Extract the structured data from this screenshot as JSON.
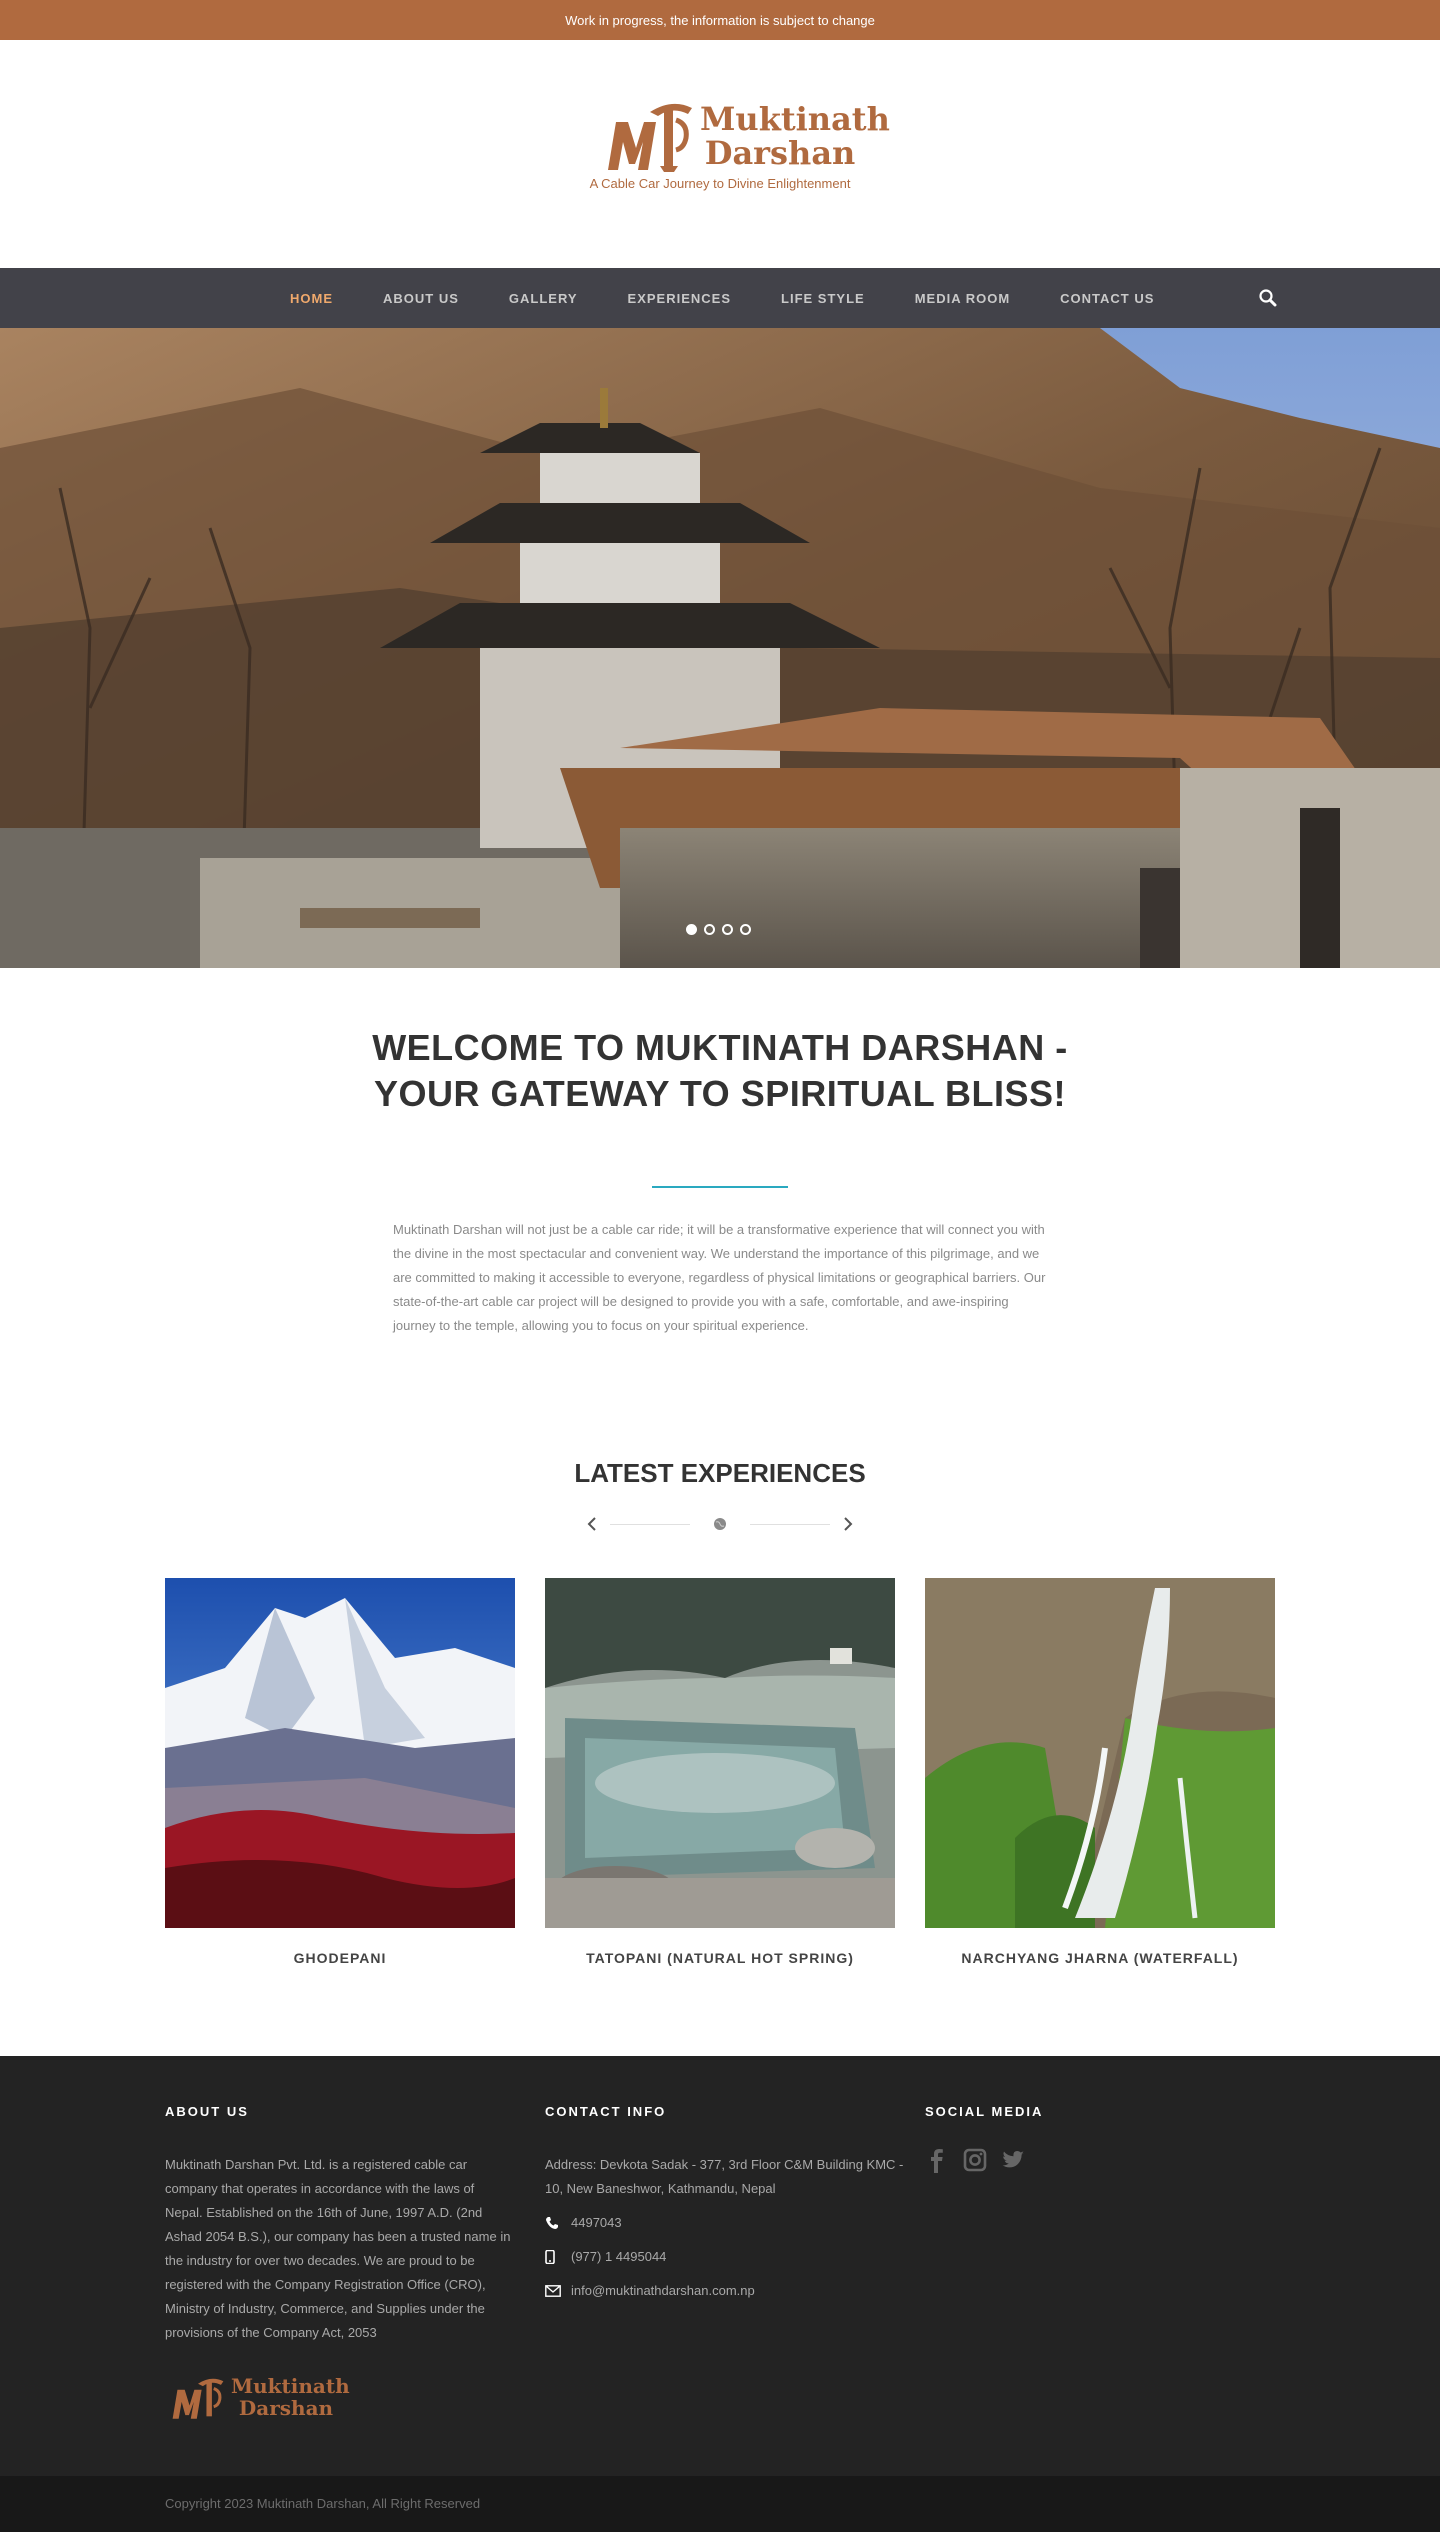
{
  "topbar": {
    "notice": "Work in progress, the information is subject to change"
  },
  "brand": {
    "name_line1": "Muktinath",
    "name_line2": "Darshan",
    "tagline": "A Cable Car Journey to Divine Enlightenment",
    "color": "#b06a3f"
  },
  "nav": {
    "items": [
      {
        "label": "HOME",
        "active": true
      },
      {
        "label": "ABOUT US"
      },
      {
        "label": "GALLERY"
      },
      {
        "label": "EXPERIENCES"
      },
      {
        "label": "LIFE STYLE"
      },
      {
        "label": "MEDIA ROOM"
      },
      {
        "label": "CONTACT US"
      }
    ],
    "search_icon": "search-icon"
  },
  "hero": {
    "slides": 4,
    "active_slide": 1
  },
  "welcome": {
    "title": "WELCOME TO MUKTINATH DARSHAN - YOUR GATEWAY TO SPIRITUAL BLISS!",
    "body": "Muktinath Darshan will not just be a cable car ride; it will be a transformative experience that will connect you with the divine in the most spectacular and convenient way. We understand the importance of this pilgrimage, and we are committed to making it accessible to everyone, regardless of physical limitations or geographical barriers. Our state-of-the-art cable car project will be designed to provide you with a safe, comfortable, and awe-inspiring journey to the temple, allowing you to focus on your spiritual experience.",
    "accent": "#2aa9c0"
  },
  "experiences": {
    "title": "LATEST EXPERIENCES",
    "cards": [
      {
        "caption": "GHODEPANI"
      },
      {
        "caption": "TATOPANI (NATURAL HOT SPRING)"
      },
      {
        "caption": "NARCHYANG JHARNA (WATERFALL)"
      }
    ]
  },
  "footer": {
    "about": {
      "heading": "ABOUT US",
      "text": "Muktinath Darshan Pvt. Ltd. is a registered cable car company that operates in accordance with the laws of Nepal. Established on the 16th of June, 1997 A.D. (2nd Ashad 2054 B.S.), our company has been a trusted name in the industry for over two decades. We are proud to be registered with the Company Registration Office (CRO), Ministry of Industry, Commerce, and Supplies under the provisions of the Company Act, 2053",
      "logo_line1": "Muktinath",
      "logo_line2": "Darshan"
    },
    "contact": {
      "heading": "CONTACT INFO",
      "address": "Address: Devkota Sadak - 377, 3rd Floor C&M Building KMC - 10, New Baneshwor, Kathmandu, Nepal",
      "phone": "4497043",
      "mobile": "(977) 1 4495044",
      "email": "info@muktinathdarshan.com.np"
    },
    "social": {
      "heading": "SOCIAL MEDIA",
      "icons": [
        "facebook-icon",
        "instagram-icon",
        "twitter-icon"
      ]
    },
    "copyright": "Copyright 2023 Muktinath Darshan, All Right Reserved"
  }
}
